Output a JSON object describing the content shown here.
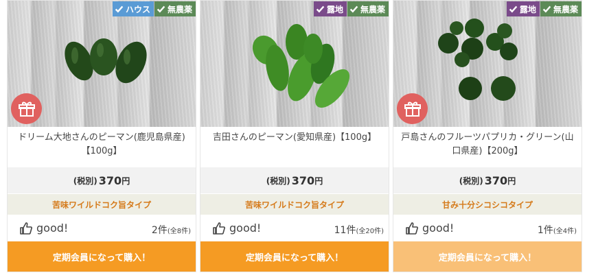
{
  "colors": {
    "tag_house": "#5a9bd5",
    "tag_outdoor": "#7a4b8a",
    "tag_no_pesticide": "#5c8a57",
    "type_text": "#d57a1a",
    "buy_active": "#f59b23",
    "buy_faded": "#f9c077"
  },
  "products": [
    {
      "tags": [
        {
          "label": "ハウス",
          "kind": "house"
        },
        {
          "label": "無農薬",
          "kind": "no_pesticide"
        }
      ],
      "gift_icon": "gift-icon",
      "name": "ドリーム大地さんのピーマン(鹿児島県産)【100g】",
      "price_tax": "(税別)",
      "price_amount": "370",
      "price_unit": "円",
      "type_text": "苦味ワイルドコク旨タイプ",
      "good_label": "good!",
      "good_count": "2件",
      "good_total": "(全8件)",
      "buy_label": "定期会員になって購入！",
      "buy_state": "active"
    },
    {
      "tags": [
        {
          "label": "露地",
          "kind": "outdoor"
        },
        {
          "label": "無農薬",
          "kind": "no_pesticide"
        }
      ],
      "gift_icon": "",
      "name": "吉田さんのピーマン(愛知県産)【100g】",
      "price_tax": "(税別)",
      "price_amount": "370",
      "price_unit": "円",
      "type_text": "苦味ワイルドコク旨タイプ",
      "good_label": "good!",
      "good_count": "11件",
      "good_total": "(全20件)",
      "buy_label": "定期会員になって購入！",
      "buy_state": "active"
    },
    {
      "tags": [
        {
          "label": "露地",
          "kind": "outdoor"
        },
        {
          "label": "無農薬",
          "kind": "no_pesticide"
        }
      ],
      "gift_icon": "gift-icon",
      "name": "戸島さんのフルーツパプリカ・グリーン(山口県産)【200g】",
      "price_tax": "(税別)",
      "price_amount": "370",
      "price_unit": "円",
      "type_text": "甘み十分シコシコタイプ",
      "good_label": "good!",
      "good_count": "1件",
      "good_total": "(全4件)",
      "buy_label": "定期会員になって購入！",
      "buy_state": "faded"
    }
  ]
}
